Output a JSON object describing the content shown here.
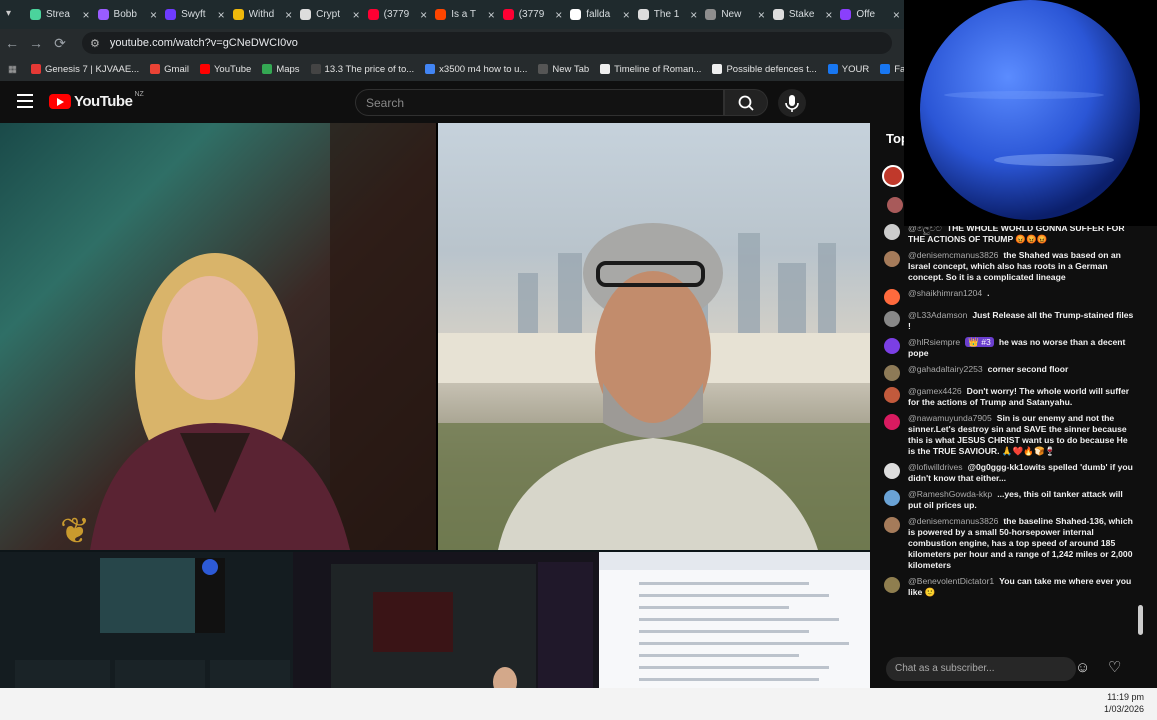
{
  "tabs": [
    {
      "title": "Strea",
      "color": "#4bd39c"
    },
    {
      "title": "Bobb",
      "color": "#9a5cff"
    },
    {
      "title": "Swyft",
      "color": "#6e3bff"
    },
    {
      "title": "Withd",
      "color": "#f0b90b"
    },
    {
      "title": "Crypt",
      "color": "#dddddd"
    },
    {
      "title": "(3779",
      "color": "#ff0033"
    },
    {
      "title": "Is a T",
      "color": "#ff4500"
    },
    {
      "title": "(3779",
      "color": "#ff0033"
    },
    {
      "title": "fallda",
      "color": "#ffffff"
    },
    {
      "title": "The 1",
      "color": "#dddddd"
    },
    {
      "title": "New",
      "color": "#8e8e8e"
    },
    {
      "title": "Stake",
      "color": "#dddddd"
    },
    {
      "title": "Offe",
      "color": "#8a3ffc"
    }
  ],
  "address": {
    "url": "youtube.com/watch?v=gCNeDWCI0vo"
  },
  "bookmarks": [
    {
      "label": "Genesis 7 | KJVAAE...",
      "color": "#e53935"
    },
    {
      "label": "Gmail",
      "color": "#ea4335"
    },
    {
      "label": "YouTube",
      "color": "#ff0000"
    },
    {
      "label": "Maps",
      "color": "#34a853"
    },
    {
      "label": "13.3 The price of to...",
      "color": "#444444"
    },
    {
      "label": "x3500 m4 how to u...",
      "color": "#4285f4"
    },
    {
      "label": "New Tab",
      "color": "#555555"
    },
    {
      "label": "Timeline of Roman...",
      "color": "#eeeeee"
    },
    {
      "label": "Possible defences t...",
      "color": "#eeeeee"
    },
    {
      "label": "YOUR",
      "color": "#1877f2"
    },
    {
      "label": "Facebook green",
      "color": "#1877f2"
    }
  ],
  "youtube": {
    "logo": "YouTube",
    "region": "NZ",
    "search_placeholder": "Search"
  },
  "chat": {
    "title": "Top",
    "input_placeholder": "Chat as a subscriber...",
    "messages": [
      {
        "author": "@මලුවිට",
        "text": "THE WHOLE WORLD GONNA SUFFER FOR THE ACTIONS OF TRUMP 😡😡😡",
        "color": "#cccccc"
      },
      {
        "author": "@denisemcmanus3826",
        "text": "the Shahed was based on an Israel concept, which also has roots in a German concept. So it is a complicated lineage",
        "color": "#a57b5a"
      },
      {
        "author": "@shaikhimran1204",
        "text": ".",
        "color": "#ff6a3d"
      },
      {
        "author": "@L33Adamson",
        "text": "Just Release all the Trump-stained files !",
        "color": "#888888"
      },
      {
        "author": "@hlRsiempre",
        "badge": "👑 #3",
        "text": "he was no worse than a decent pope",
        "color": "#7b3fe4"
      },
      {
        "author": "@gahadaltairy2253",
        "text": "corner second floor",
        "color": "#8d7a57"
      },
      {
        "author": "@gamex4426",
        "text": "Don't worry! The whole world will suffer for the actions of Trump and Satanyahu.",
        "color": "#c25a3c"
      },
      {
        "author": "@nawamuyunda7905",
        "text": "Sin is our enemy and not the sinner.Let's destroy sin and SAVE the sinner because this is what JESUS CHRIST want us to do because He is the TRUE SAVIOUR. 🙏❤️🔥🍞🍷",
        "color": "#d81b60"
      },
      {
        "author": "@lofiwilldrives",
        "text": "@0g0ggg-kk1owits spelled 'dumb' if you didn't know that either...",
        "color": "#dddddd"
      },
      {
        "author": "@RameshGowda-kkp",
        "text": "...yes, this oil tanker attack will put oil prices up.",
        "color": "#6aa3d6"
      },
      {
        "author": "@denisemcmanus3826",
        "text": "the baseline Shahed-136, which is powered by a small 50-horsepower internal combustion engine, has a top speed of around 185 kilometers per hour and a range of 1,242 miles or 2,000 kilometers",
        "color": "#a57b5a"
      },
      {
        "author": "@BenevolentDictator1",
        "text": "You can take me where ever you like 🙂",
        "color": "#8f7e4f"
      }
    ]
  },
  "taskbar": {
    "time": "11:19 pm",
    "date": "1/03/2026"
  }
}
